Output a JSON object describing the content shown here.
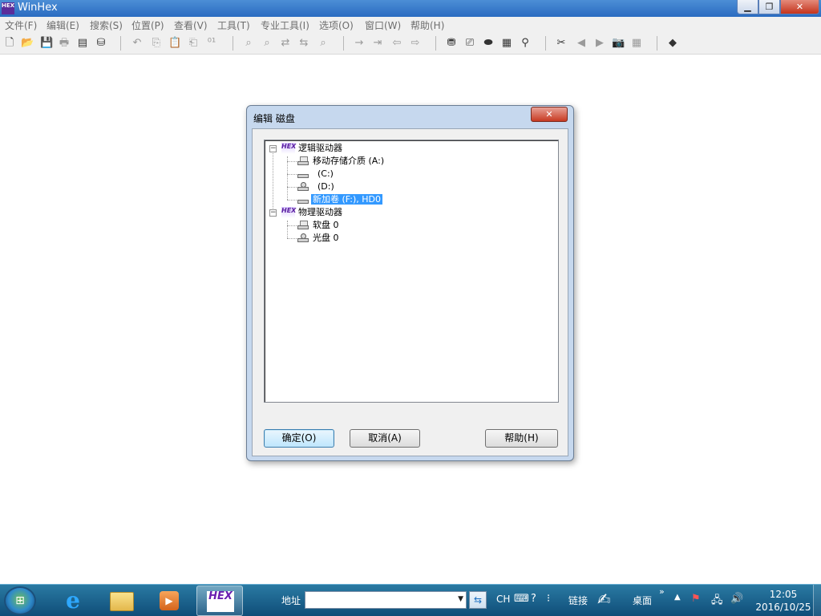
{
  "window": {
    "title": "WinHex",
    "logo_text": "HEX",
    "min_label": "▁",
    "max_label": "❐",
    "close_label": "✕"
  },
  "menu": [
    "文件(F)",
    "编辑(E)",
    "搜索(S)",
    "位置(P)",
    "查看(V)",
    "工具(T)",
    "专业工具(I)",
    "选项(O)",
    "窗口(W)",
    "帮助(H)"
  ],
  "toolbar_icons": [
    {
      "name": "new-file-icon",
      "glyph": "🗋",
      "disabled": false
    },
    {
      "name": "open-folder-icon",
      "glyph": "📂",
      "disabled": false
    },
    {
      "name": "save-icon",
      "glyph": "💾",
      "disabled": true
    },
    {
      "name": "print-icon",
      "glyph": "🖶",
      "disabled": true
    },
    {
      "name": "properties-icon",
      "glyph": "▤",
      "disabled": false
    },
    {
      "name": "open-disk-icon",
      "glyph": "⛁",
      "disabled": false
    },
    {
      "name": "undo-icon",
      "glyph": "↶",
      "disabled": true
    },
    {
      "name": "copy-icon",
      "glyph": "⎘",
      "disabled": true
    },
    {
      "name": "paste-icon",
      "glyph": "📋",
      "disabled": true
    },
    {
      "name": "paste-special-icon",
      "glyph": "⎗",
      "disabled": true
    },
    {
      "name": "binary-icon",
      "glyph": "⁰¹",
      "disabled": true
    },
    {
      "name": "find-text-icon",
      "glyph": "⌕",
      "disabled": true
    },
    {
      "name": "find-hex-icon",
      "glyph": "⌕",
      "disabled": true
    },
    {
      "name": "replace-text-icon",
      "glyph": "⇄",
      "disabled": true
    },
    {
      "name": "replace-hex-icon",
      "glyph": "⇆",
      "disabled": true
    },
    {
      "name": "find-again-icon",
      "glyph": "⌕",
      "disabled": true
    },
    {
      "name": "goto-offset-icon",
      "glyph": "→",
      "disabled": true
    },
    {
      "name": "goto-sector-icon",
      "glyph": "⇥",
      "disabled": true
    },
    {
      "name": "back-icon",
      "glyph": "⇦",
      "disabled": true
    },
    {
      "name": "forward-icon",
      "glyph": "⇨",
      "disabled": true
    },
    {
      "name": "edit-disk-icon",
      "glyph": "⛃",
      "disabled": false
    },
    {
      "name": "open-ram-icon",
      "glyph": "⎚",
      "disabled": false
    },
    {
      "name": "drive-icon",
      "glyph": "⬬",
      "disabled": false
    },
    {
      "name": "ram-icon",
      "glyph": "▦",
      "disabled": false
    },
    {
      "name": "search-icon",
      "glyph": "⚲",
      "disabled": false
    },
    {
      "name": "close-file-icon",
      "glyph": "✂",
      "disabled": false
    },
    {
      "name": "prev-icon",
      "glyph": "◀",
      "disabled": true
    },
    {
      "name": "next-icon",
      "glyph": "▶",
      "disabled": true
    },
    {
      "name": "camera-icon",
      "glyph": "📷",
      "disabled": true
    },
    {
      "name": "calculator-icon",
      "glyph": "▦",
      "disabled": true
    },
    {
      "name": "help-book-icon",
      "glyph": "◆",
      "disabled": false
    }
  ],
  "dialog": {
    "title": "编辑 磁盘",
    "close_label": "✕",
    "tree": {
      "logical_group": "逻辑驱动器",
      "logical_items": [
        "移动存储介质 (A:)",
        "(C:)",
        "(D:)",
        "新加卷 (F:), HD0"
      ],
      "physical_group": "物理驱动器",
      "physical_items": [
        "软盘 0",
        "光盘 0"
      ],
      "selected": "新加卷 (F:), HD0",
      "expander_glyph": "−"
    },
    "buttons": {
      "ok": "确定(O)",
      "cancel": "取消(A)",
      "help": "帮助(H)"
    }
  },
  "taskbar": {
    "hex_label": "HEX",
    "address_label": "地址",
    "address_value": "",
    "go_glyph": "⇆",
    "lang": "CH",
    "links_label": "链接",
    "desktop_label": "桌面",
    "chevron": "»",
    "clock_time": "12:05",
    "clock_date": "2016/10/25"
  }
}
